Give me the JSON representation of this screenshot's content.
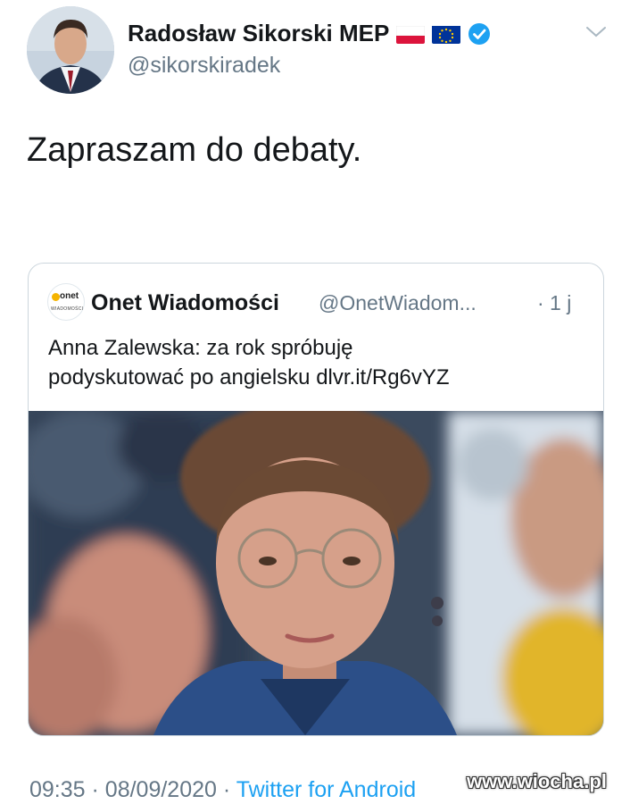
{
  "tweet": {
    "author": {
      "name": "Radosław Sikorski MEP",
      "handle": "@sikorskiradek"
    },
    "text": "Zapraszam do debaty.",
    "timestamp_time": "09:35",
    "timestamp_date": "08/09/2020",
    "separator": "·",
    "source": "Twitter for Android"
  },
  "quoted_tweet": {
    "name": "Onet Wiadomości",
    "handle": "@OnetWiadom...",
    "time": "· 1 j",
    "text_line1": "Anna Zalewska: za rok spróbuję",
    "text_line2": "podyskutować po angielsku dlvr.it/Rg6vYZ",
    "avatar_text": "onet",
    "avatar_subtext": "WIADOMOŚCI"
  },
  "watermark": "www.wiocha.pl",
  "icons": {
    "flag_poland": "poland-flag-icon",
    "flag_eu": "eu-flag-icon",
    "verified": "verified-badge-icon",
    "caret": "chevron-down-icon"
  },
  "colors": {
    "link_blue": "#1da1f2",
    "muted_gray": "#657786",
    "text_dark": "#14171a",
    "border": "#ccd6dd"
  }
}
